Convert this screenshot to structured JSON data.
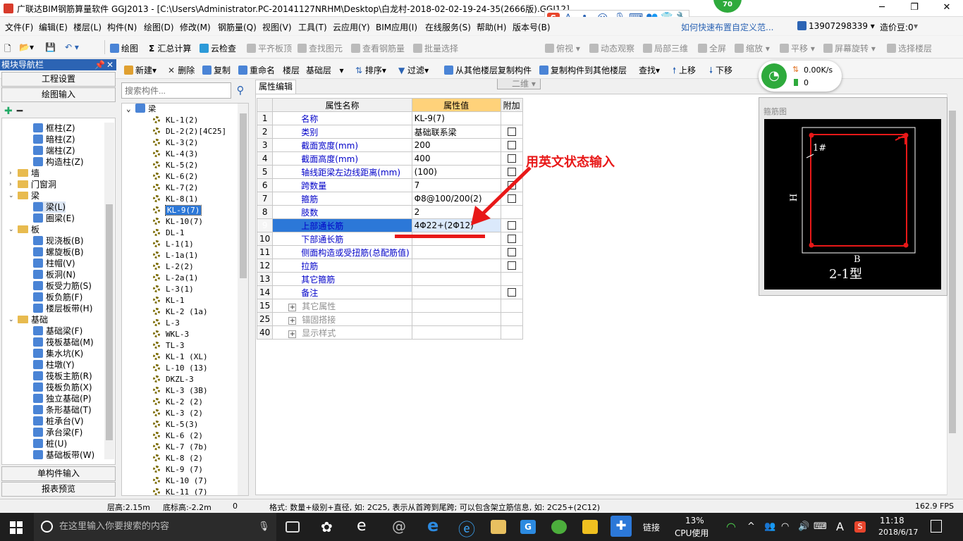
{
  "window": {
    "title": "广联达BIM钢筋算量软件 GGJ2013 - [C:\\Users\\Administrator.PC-20141127NRHM\\Desktop\\白龙村-2018-02-02-19-24-35(2666版).GGJ12]",
    "badge": "70"
  },
  "menu": [
    "文件(F)",
    "编辑(E)",
    "楼层(L)",
    "构件(N)",
    "绘图(D)",
    "修改(M)",
    "钢筋量(Q)",
    "视图(V)",
    "工具(T)",
    "云应用(Y)",
    "BIM应用(I)",
    "在线服务(S)",
    "帮助(H)",
    "版本号(B)"
  ],
  "menu_right": {
    "tip": "如何快速布置自定义范...",
    "phone": "13907298339",
    "beans": "造价豆:0"
  },
  "toolbar1": [
    "绘图",
    "汇总计算",
    "云检查",
    "平齐板顶",
    "查找图元",
    "查看钢筋量",
    "批量选择",
    "二维",
    "俯视",
    "动态观察",
    "局部三维",
    "全屏",
    "缩放",
    "平移",
    "屏幕旋转",
    "选择楼层"
  ],
  "toolbar2": [
    "新建",
    "删除",
    "复制",
    "重命名",
    "楼层",
    "基础层",
    "排序",
    "过滤",
    "从其他楼层复制构件",
    "复制构件到其他楼层",
    "查找",
    "上移",
    "下移"
  ],
  "net": {
    "speed": "0.00K/s",
    "count": "0"
  },
  "nav": {
    "title": "模块导航栏",
    "buttons": [
      "工程设置",
      "绘图输入"
    ],
    "bottom_buttons": [
      "单构件输入",
      "报表预览"
    ],
    "items": [
      "框柱(Z)",
      "暗柱(Z)",
      "端柱(Z)",
      "构造柱(Z)",
      "墙",
      "门窗洞",
      "梁",
      "梁(L)",
      "圈梁(E)",
      "板",
      "现浇板(B)",
      "螺旋板(B)",
      "柱帽(V)",
      "板洞(N)",
      "板受力筋(S)",
      "板负筋(F)",
      "楼层板带(H)",
      "基础",
      "基础梁(F)",
      "筏板基础(M)",
      "集水坑(K)",
      "柱墩(Y)",
      "筏板主筋(R)",
      "筏板负筋(X)",
      "独立基础(P)",
      "条形基础(T)",
      "桩承台(V)",
      "承台梁(F)",
      "桩(U)",
      "基础板带(W)"
    ]
  },
  "search": {
    "placeholder": "搜索构件..."
  },
  "components": {
    "root": "梁",
    "selected": "KL-9(7)",
    "items": [
      "KL-1(2)",
      "DL-2(2)[4C25]",
      "KL-3(2)",
      "KL-4(3)",
      "KL-5(2)",
      "KL-6(2)",
      "KL-7(2)",
      "KL-8(1)",
      "KL-9(7)",
      "KL-10(7)",
      "DL-1",
      "L-1(1)",
      "L-1a(1)",
      "L-2(2)",
      "L-2a(1)",
      "L-3(1)",
      "KL-1",
      "KL-2 (1a)",
      "L-3",
      "WKL-3",
      "TL-3",
      "KL-1 (XL)",
      "L-10 (13)",
      "DKZL-3",
      "KL-3 (3B)",
      "KL-2 (2)",
      "KL-3 (2)",
      "KL-5(3)",
      "KL-6 (2)",
      "KL-7 (7b)",
      "KL-8 (2)",
      "KL-9 (7)",
      "KL-10 (7)",
      "KL-11 (7)"
    ]
  },
  "props": {
    "tab": "属性编辑",
    "headers": [
      "属性名称",
      "属性值",
      "附加"
    ],
    "rows": [
      {
        "n": "1",
        "name": "名称",
        "value": "KL-9(7)",
        "cb": false
      },
      {
        "n": "2",
        "name": "类别",
        "value": "基础联系梁",
        "cb": true
      },
      {
        "n": "3",
        "name": "截面宽度(mm)",
        "value": "200",
        "cb": true
      },
      {
        "n": "4",
        "name": "截面高度(mm)",
        "value": "400",
        "cb": true
      },
      {
        "n": "5",
        "name": "轴线距梁左边线距离(mm)",
        "value": "(100)",
        "cb": true
      },
      {
        "n": "6",
        "name": "跨数量",
        "value": "7",
        "cb": true
      },
      {
        "n": "7",
        "name": "箍筋",
        "value": "Φ8@100/200(2)",
        "cb": true
      },
      {
        "n": "8",
        "name": "肢数",
        "value": "2",
        "cb": false
      },
      {
        "n": "9",
        "name": "上部通长筋",
        "value": "4Φ22+(2Φ12)",
        "cb": true
      },
      {
        "n": "10",
        "name": "下部通长筋",
        "value": "",
        "cb": true
      },
      {
        "n": "11",
        "name": "侧面构造或受扭筋(总配筋值)",
        "value": "",
        "cb": true
      },
      {
        "n": "12",
        "name": "拉筋",
        "value": "",
        "cb": true
      },
      {
        "n": "13",
        "name": "其它箍筋",
        "value": "",
        "cb": false
      },
      {
        "n": "14",
        "name": "备注",
        "value": "",
        "cb": true
      },
      {
        "n": "15",
        "name": "其它属性",
        "value": "",
        "cb": false,
        "group": true
      },
      {
        "n": "25",
        "name": "锚固搭接",
        "value": "",
        "cb": false,
        "group": true
      },
      {
        "n": "40",
        "name": "显示样式",
        "value": "",
        "cb": false,
        "group": true
      }
    ]
  },
  "annotation": "用英文状态输入",
  "stirrup": {
    "title": "箍筋图",
    "label_1": "1#",
    "label_h": "H",
    "label_b": "B",
    "type": "2-1型"
  },
  "status": {
    "floor_h": "层高:2.15m",
    "base_h": "底标高:-2.2m",
    "zero": "0",
    "hint": "格式: 数量+级别+直径, 如: 2C25, 表示从首跨到尾跨; 可以包含架立筋信息, 如: 2C25+(2C12)",
    "fps": "162.9 FPS"
  },
  "taskbar": {
    "search_placeholder": "在这里输入你要搜索的内容",
    "link": "链接",
    "cpu_pct": "13%",
    "cpu_label": "CPU使用",
    "ime": "A",
    "time": "11:18",
    "date": "2018/6/17"
  },
  "colors": {
    "accent": "#2c78d8",
    "annot": "#e81818",
    "header_val": "#ffd27a"
  }
}
